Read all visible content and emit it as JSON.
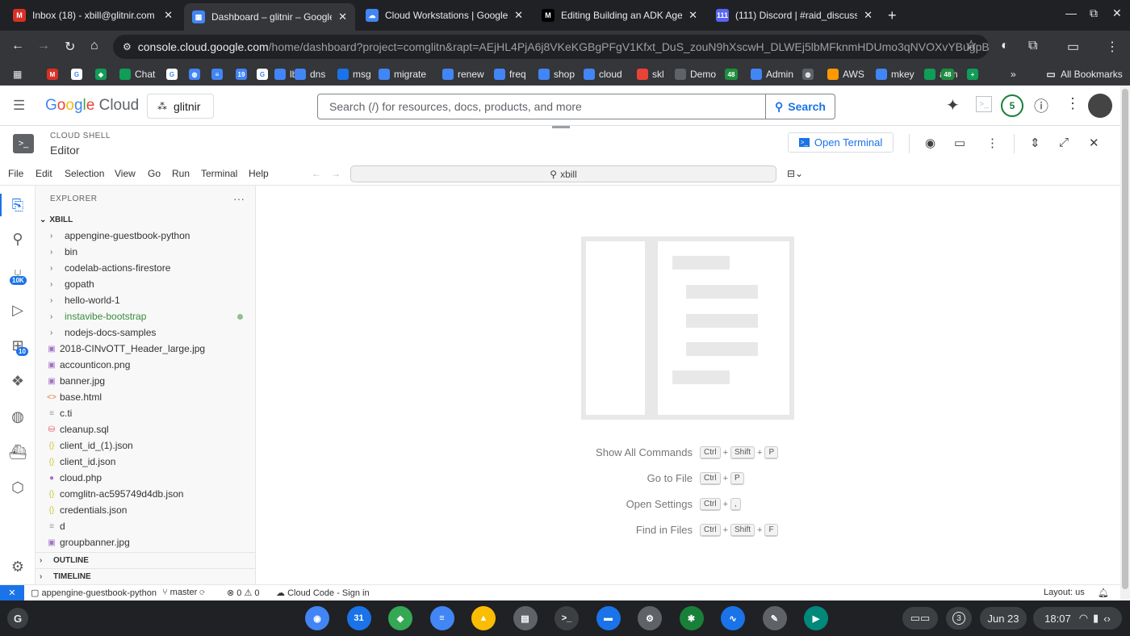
{
  "browser": {
    "tabs": [
      {
        "title": "Inbox (18) - xbill@glitnir.com - G",
        "fav": "M",
        "color": "#d93025"
      },
      {
        "title": "Dashboard – glitnir – Google Cl",
        "fav": "▦",
        "color": "#4285f4"
      },
      {
        "title": "Cloud Workstations | Google Cl",
        "fav": "☁",
        "color": "#4285f4"
      },
      {
        "title": "Editing Building an ADK Agent f",
        "fav": "M",
        "color": "#000000"
      },
      {
        "title": "(111) Discord | #raid_discussio",
        "fav": "111",
        "color": "#5865f2"
      }
    ],
    "new_tab": "+",
    "address_host": "console.cloud.google.com",
    "address_path": "/home/dashboard?project=comglitn&rapt=AEjHL4PjA6j8VKeKGBgPFgV1Kfxt_DuS_zouN9hXscwH_DLWEj5lbMFknmHDUmo3qNVOXvYBugpBy_Q-714...",
    "bookmarks": [
      "Chat",
      "lb",
      "dns",
      "msg",
      "migrate",
      "renew",
      "freq",
      "shop",
      "cloud",
      "skl",
      "Demo",
      "Admin",
      "AWS",
      "mkey",
      "asm"
    ],
    "bookmark_badge": "48",
    "all_bookmarks": "All Bookmarks"
  },
  "gcp": {
    "logo": "Google Cloud",
    "project": "glitnir",
    "search_placeholder": "Search (/) for resources, docs, products, and more",
    "search_button": "Search",
    "notifications": "5"
  },
  "cloudshell": {
    "label": "CLOUD SHELL",
    "title": "Editor",
    "open_terminal": "Open Terminal"
  },
  "menubar": {
    "items": [
      "File",
      "Edit",
      "Selection",
      "View",
      "Go",
      "Run",
      "Terminal",
      "Help"
    ],
    "command_center": "xbill"
  },
  "activity": {
    "source_control_badge": "10K",
    "extensions_badge": "10"
  },
  "explorer": {
    "header": "EXPLORER",
    "root": "XBILL",
    "folders": [
      "appengine-guestbook-python",
      "bin",
      "codelab-actions-firestore",
      "gopath",
      "hello-world-1",
      "instavibe-bootstrap",
      "nodejs-docs-samples"
    ],
    "files": [
      {
        "name": "2018-CINvOTT_Header_large.jpg",
        "icon": "▣",
        "color": "#a074c4"
      },
      {
        "name": "accounticon.png",
        "icon": "▣",
        "color": "#a074c4"
      },
      {
        "name": "banner.jpg",
        "icon": "▣",
        "color": "#a074c4"
      },
      {
        "name": "base.html",
        "icon": "<>",
        "color": "#e37933"
      },
      {
        "name": "c.ti",
        "icon": "≡",
        "color": "#999999"
      },
      {
        "name": "cleanup.sql",
        "icon": "⛁",
        "color": "#e44d6b"
      },
      {
        "name": "client_id_(1).json",
        "icon": "{}",
        "color": "#cbcb41"
      },
      {
        "name": "client_id.json",
        "icon": "{}",
        "color": "#cbcb41"
      },
      {
        "name": "cloud.php",
        "icon": "●",
        "color": "#a074c4"
      },
      {
        "name": "comglitn-ac595749d4db.json",
        "icon": "{}",
        "color": "#cbcb41"
      },
      {
        "name": "credentials.json",
        "icon": "{}",
        "color": "#cbcb41"
      },
      {
        "name": "d",
        "icon": "≡",
        "color": "#999999"
      },
      {
        "name": "groupbanner.jpg",
        "icon": "▣",
        "color": "#a074c4"
      }
    ],
    "outline": "OUTLINE",
    "timeline": "TIMELINE"
  },
  "welcome": {
    "shortcuts": [
      {
        "label": "Show All Commands",
        "keys": [
          "Ctrl",
          "Shift",
          "P"
        ]
      },
      {
        "label": "Go to File",
        "keys": [
          "Ctrl",
          "P"
        ]
      },
      {
        "label": "Open Settings",
        "keys": [
          "Ctrl",
          ","
        ]
      },
      {
        "label": "Find in Files",
        "keys": [
          "Ctrl",
          "Shift",
          "F"
        ]
      }
    ]
  },
  "statusbar": {
    "folder": "appengine-guestbook-python",
    "branch": "master",
    "errors": "0",
    "warnings": "0",
    "cloud_code": "Cloud Code - Sign in",
    "layout": "Layout: us"
  },
  "shelf": {
    "apps": [
      {
        "name": "chrome",
        "color": "#4285f4",
        "glyph": "◉"
      },
      {
        "name": "calendar",
        "color": "#1a73e8",
        "glyph": "31"
      },
      {
        "name": "maps",
        "color": "#34a853",
        "glyph": "◆"
      },
      {
        "name": "docs",
        "color": "#4285f4",
        "glyph": "≡"
      },
      {
        "name": "drive",
        "color": "#fbbc04",
        "glyph": "▲"
      },
      {
        "name": "cloud-shell",
        "color": "#5f6368",
        "glyph": "▤"
      },
      {
        "name": "terminal",
        "color": "#3c4043",
        "glyph": ">_"
      },
      {
        "name": "files",
        "color": "#1a73e8",
        "glyph": "▬"
      },
      {
        "name": "settings",
        "color": "#5f6368",
        "glyph": "⚙"
      },
      {
        "name": "app-green",
        "color": "#188038",
        "glyph": "✱"
      },
      {
        "name": "monitor",
        "color": "#1a73e8",
        "glyph": "∿"
      },
      {
        "name": "tools",
        "color": "#5f6368",
        "glyph": "✎"
      },
      {
        "name": "meet",
        "color": "#00897b",
        "glyph": "▶"
      }
    ],
    "notification_count": "3",
    "date": "Jun 23",
    "time": "18:07"
  }
}
